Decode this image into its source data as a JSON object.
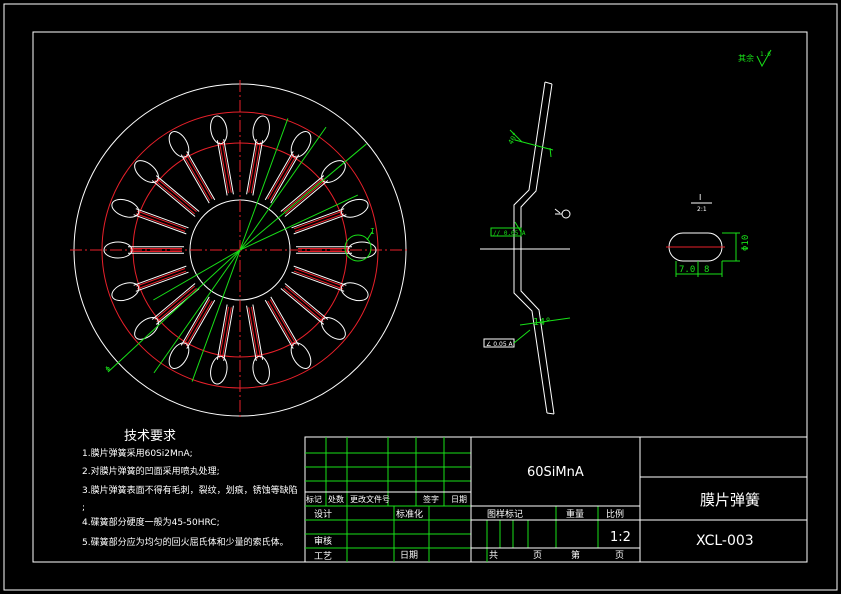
{
  "tech": {
    "title": "技术要求",
    "notes": [
      "1.膜片弹簧采用60Si2MnA;",
      "2.对膜片弹簧的凹面采用喷丸处理;",
      "3.膜片弹簧表面不得有毛刺，裂纹，划痕，锈蚀等缺陷",
      ";",
      "4.碟簧部分硬度一般为45-50HRC;",
      "5.碟簧部分应为均匀的回火屈氏体和少量的索氏体。"
    ]
  },
  "title_block": {
    "material": "60SiMnA",
    "part_name": "膜片弹簧",
    "drawing_no": "XCL-003",
    "scale": "1:2",
    "headers": [
      "图样标记",
      "重量",
      "比例"
    ],
    "row_labels": [
      "标记",
      "处数",
      "更改文件号",
      "签字",
      "日期"
    ],
    "design": "设计",
    "standard": "标准化",
    "review": "审核",
    "process": "工艺",
    "date": "日期",
    "total": "共",
    "page": "页",
    "nth": "第",
    "page2": "页"
  },
  "annotations": {
    "roughness": "其余",
    "roughness_val": "1.6",
    "angle1": "14°",
    "view_label": "I",
    "scale_label": "2:1",
    "dim1": "7.0",
    "dim2": "8",
    "dim3": "Φ10",
    "tol1": "// 0.05 A",
    "tol2": "∠ 0.05 A",
    "angle2": "40°"
  },
  "colors": {
    "line": "#ffffff",
    "center": "#e8202a",
    "dimension": "#18e018"
  }
}
